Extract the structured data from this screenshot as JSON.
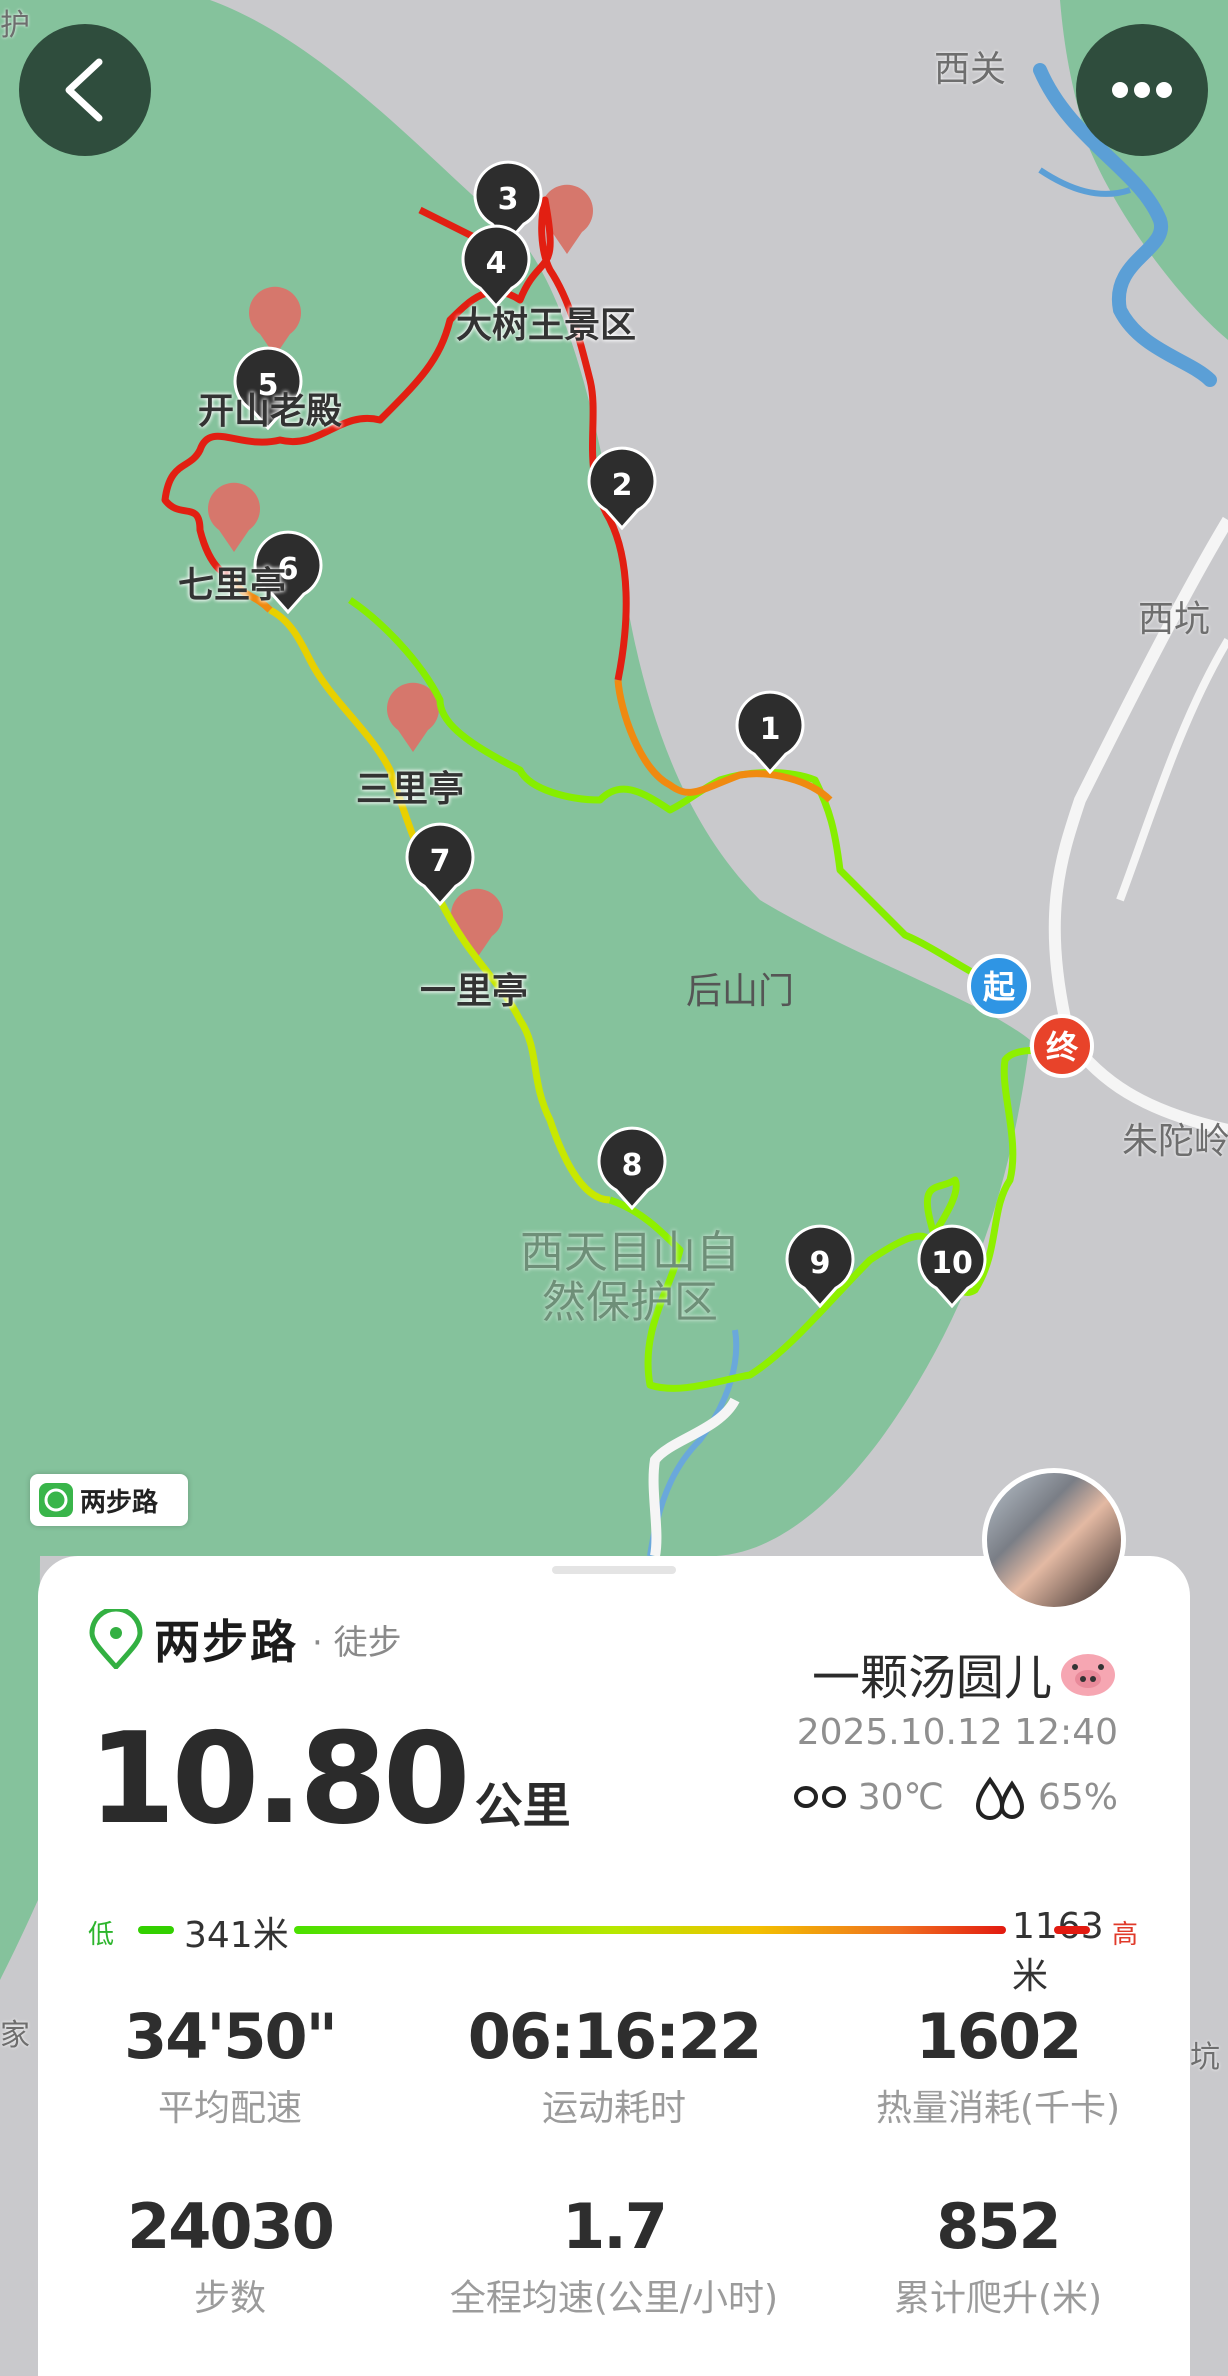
{
  "map": {
    "places": {
      "xiguan": "西关",
      "dashuwang": "大树王景区",
      "kaishan": "开山老殿",
      "qili": "七里亭",
      "sanli": "三里亭",
      "yili": "一里亭",
      "houshanmen": "后山门",
      "xikeng": "西坑",
      "zhutuoling": "朱陀岭",
      "reserve": "西天目山自然保护区",
      "edge_hu": "护",
      "edge_jia": "家",
      "edge_keng": "坑"
    },
    "markers": [
      "1",
      "2",
      "3",
      "4",
      "5",
      "6",
      "7",
      "8",
      "9",
      "10"
    ],
    "start_label": "起",
    "end_label": "终",
    "watermark": "两步路",
    "colors": {
      "forest": "#85c29c",
      "land": "#c9c9cc",
      "water": "#5b9fd6",
      "route_low": "#7ef000",
      "route_high": "#e31a10",
      "start": "#2f95e4",
      "end": "#e8432a"
    }
  },
  "buttons": {
    "back_icon": "chevron-left-icon",
    "more_icon": "more-horizontal-icon"
  },
  "card": {
    "brand": "两步路",
    "activity": "· 徒步",
    "distance": "10.80",
    "distance_unit": "公里",
    "user": "一颗汤圆儿",
    "datetime": "2025.10.12 12:40",
    "temperature": "30℃",
    "humidity": "65%",
    "elevation": {
      "low_label": "低",
      "high_label": "高",
      "min": "341米",
      "max": "1163米"
    },
    "stats": [
      {
        "value": "34'50\"",
        "label": "平均配速"
      },
      {
        "value": "06:16:22",
        "label": "运动耗时"
      },
      {
        "value": "1602",
        "label": "热量消耗(千卡)"
      },
      {
        "value": "24030",
        "label": "步数"
      },
      {
        "value": "1.7",
        "label": "全程均速(公里/小时)"
      },
      {
        "value": "852",
        "label": "累计爬升(米)"
      }
    ]
  }
}
